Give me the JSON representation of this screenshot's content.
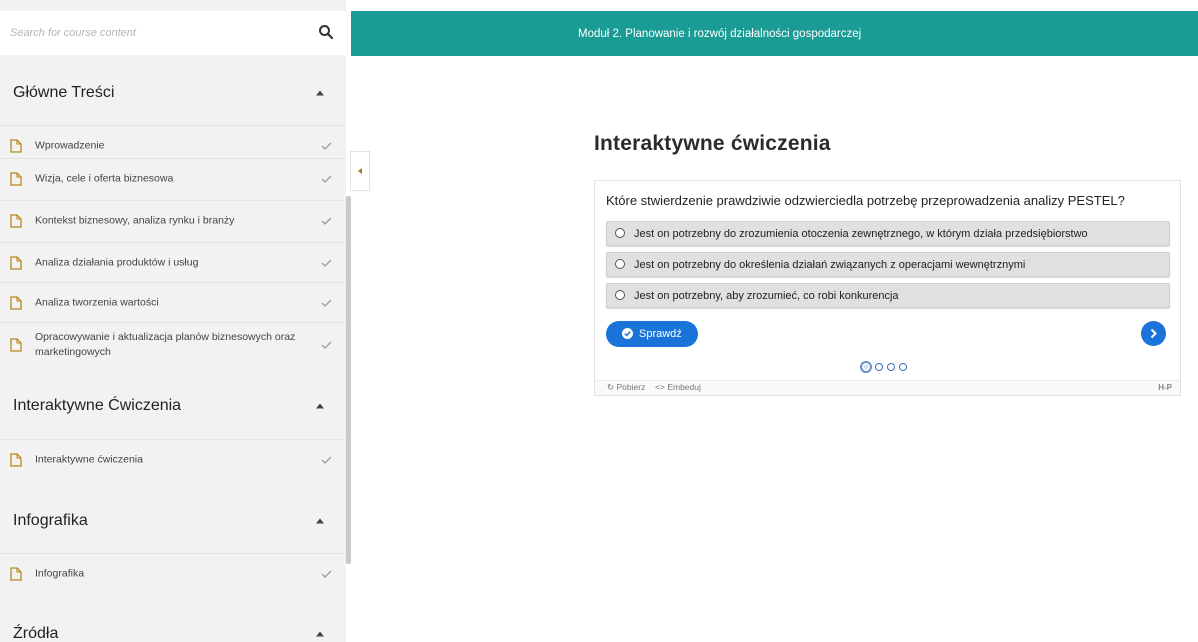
{
  "search": {
    "placeholder": "Search for course content",
    "icon": "search-icon"
  },
  "sidebar": {
    "sections": [
      {
        "title": "Główne Treści",
        "items": [
          {
            "label": "Wprowadzenie",
            "completed": true
          },
          {
            "label": "Wizja, cele i oferta biznesowa",
            "completed": true
          },
          {
            "label": "Kontekst biznesowy, analiza rynku i branży",
            "completed": true
          },
          {
            "label": "Analiza działania produktów i usług",
            "completed": true
          },
          {
            "label": "Analiza tworzenia wartości",
            "completed": true
          },
          {
            "label": "Opracowywanie i aktualizacja planów biznesowych oraz marketingowych",
            "completed": true
          }
        ]
      },
      {
        "title": "Interaktywne Ćwiczenia",
        "items": [
          {
            "label": "Interaktywne ćwiczenia",
            "completed": true
          }
        ]
      },
      {
        "title": "Infografika",
        "items": [
          {
            "label": "Infografika",
            "completed": true
          }
        ]
      },
      {
        "title": "Źródła",
        "items": []
      }
    ]
  },
  "header": {
    "module_title": "Moduł 2. Planowanie i rozwój działalności gospodarczej",
    "accent": "#1a9c94"
  },
  "main": {
    "title": "Interaktywne ćwiczenia",
    "quiz": {
      "question": "Które stwierdzenie prawdziwie odzwierciedla potrzebę przeprowadzenia analizy PESTEL?",
      "answers": [
        "Jest on potrzebny do zrozumienia otoczenia zewnętrznego, w którym działa przedsiębiorstwo",
        "Jest on potrzebny do określenia działań związanych z operacjami wewnętrznymi",
        "Jest on potrzebny, aby zrozumieć, co robi konkurencja"
      ],
      "check_label": "Sprawdź",
      "button_color": "#1a73d9",
      "pages_total": 4,
      "current_page": 1
    },
    "footer": {
      "download_label": "Pobierz",
      "embed_label": "Embeduj",
      "logo": "H-P"
    }
  }
}
